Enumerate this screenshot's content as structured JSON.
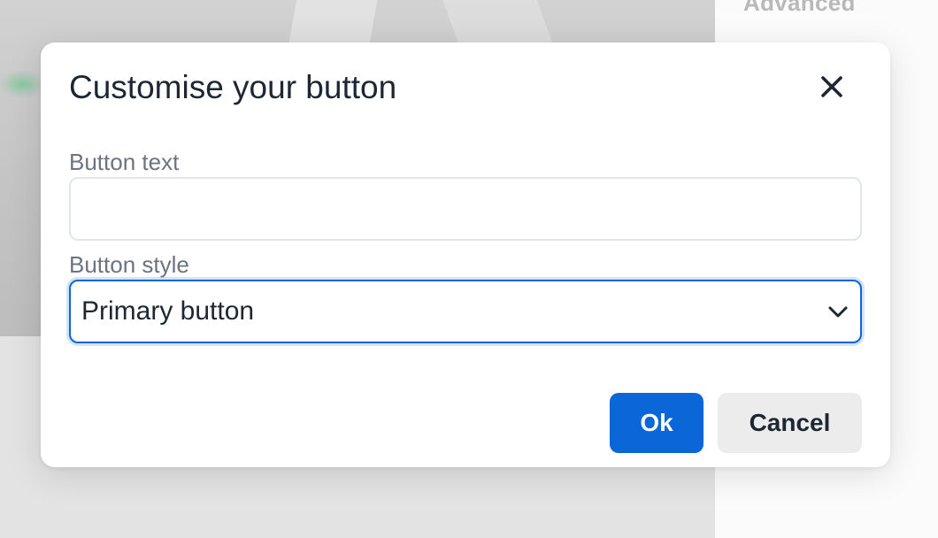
{
  "background": {
    "side_label": "Advanced"
  },
  "modal": {
    "title": "Customise your button",
    "close_icon": "close-icon",
    "fields": {
      "button_text": {
        "label": "Button text",
        "value": "",
        "placeholder": ""
      },
      "button_style": {
        "label": "Button style",
        "selected": "Primary button",
        "chevron_icon": "chevron-down-icon"
      }
    },
    "actions": {
      "ok_label": "Ok",
      "cancel_label": "Cancel"
    }
  },
  "colors": {
    "primary": "#0b66d8",
    "text": "#1d2733",
    "muted_label": "#6b7480",
    "secondary_button": "#ececec"
  }
}
